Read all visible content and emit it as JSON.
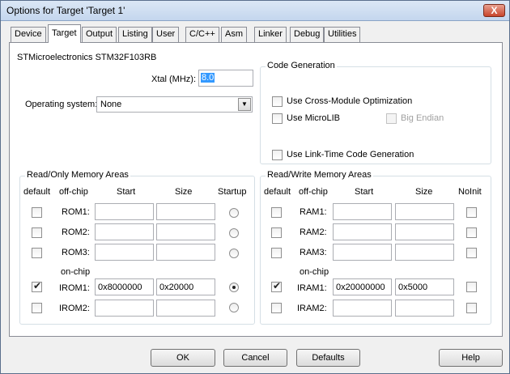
{
  "window": {
    "title": "Options for Target 'Target 1'",
    "close_glyph": "X"
  },
  "tabs": [
    "Device",
    "Target",
    "Output",
    "Listing",
    "User",
    "C/C++",
    "Asm",
    "Linker",
    "Debug",
    "Utilities"
  ],
  "device_name": "STMicroelectronics STM32F103RB",
  "xtal": {
    "label": "Xtal (MHz):",
    "value": "8.0"
  },
  "os": {
    "label": "Operating system:",
    "value": "None"
  },
  "code_generation": {
    "title": "Code Generation",
    "cross_module": "Use Cross-Module Optimization",
    "microlib": "Use MicroLIB",
    "big_endian": "Big Endian",
    "ltcg": "Use Link-Time Code Generation"
  },
  "rom": {
    "title": "Read/Only Memory Areas",
    "headers": {
      "default": "default",
      "offchip": "off-chip",
      "start": "Start",
      "size": "Size",
      "startup": "Startup"
    },
    "onchip_label": "on-chip",
    "rows": [
      {
        "label": "ROM1:",
        "start": "",
        "size": ""
      },
      {
        "label": "ROM2:",
        "start": "",
        "size": ""
      },
      {
        "label": "ROM3:",
        "start": "",
        "size": ""
      },
      {
        "label": "IROM1:",
        "start": "0x8000000",
        "size": "0x20000"
      },
      {
        "label": "IROM2:",
        "start": "",
        "size": ""
      }
    ]
  },
  "ram": {
    "title": "Read/Write Memory Areas",
    "headers": {
      "default": "default",
      "offchip": "off-chip",
      "start": "Start",
      "size": "Size",
      "noinit": "NoInit"
    },
    "onchip_label": "on-chip",
    "rows": [
      {
        "label": "RAM1:",
        "start": "",
        "size": ""
      },
      {
        "label": "RAM2:",
        "start": "",
        "size": ""
      },
      {
        "label": "RAM3:",
        "start": "",
        "size": ""
      },
      {
        "label": "IRAM1:",
        "start": "0x20000000",
        "size": "0x5000"
      },
      {
        "label": "IRAM2:",
        "start": "",
        "size": ""
      }
    ]
  },
  "buttons": {
    "ok": "OK",
    "cancel": "Cancel",
    "defaults": "Defaults",
    "help": "Help"
  }
}
